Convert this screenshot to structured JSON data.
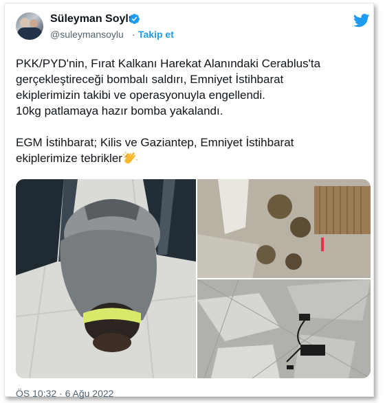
{
  "tweet": {
    "author_name": "Süleyman Soylu",
    "handle": "@suleymansoylu",
    "separator": "·",
    "follow_label": "Takip et",
    "verified": true,
    "paragraph1_line1": "PKK/PYD'nin, Fırat Kalkanı Harekat Alanındaki Cerablus'ta",
    "paragraph1_line2": "gerçekleştireceği bombalı saldırı, Emniyet İstihbarat",
    "paragraph1_line3": "ekiplerimizin takibi ve operasyonuyla engellendi.",
    "paragraph1_line4": "10kg patlamaya hazır bomba yakalandı.",
    "paragraph2_line1": "EGM İstihbarat; Kilis ve Gaziantep, Emniyet İstihbarat",
    "paragraph2_line2": "ekiplerimize tebrikler",
    "timestamp": "ÖS 10:32 · 6 Ağu 2022"
  },
  "icons": {
    "verified": "verified-badge-icon",
    "logo": "twitter-bird-icon",
    "emoji": "clapping-hands-emoji"
  },
  "colors": {
    "accent": "#1d9bf0",
    "text": "#0f1419",
    "secondary": "#536471"
  }
}
